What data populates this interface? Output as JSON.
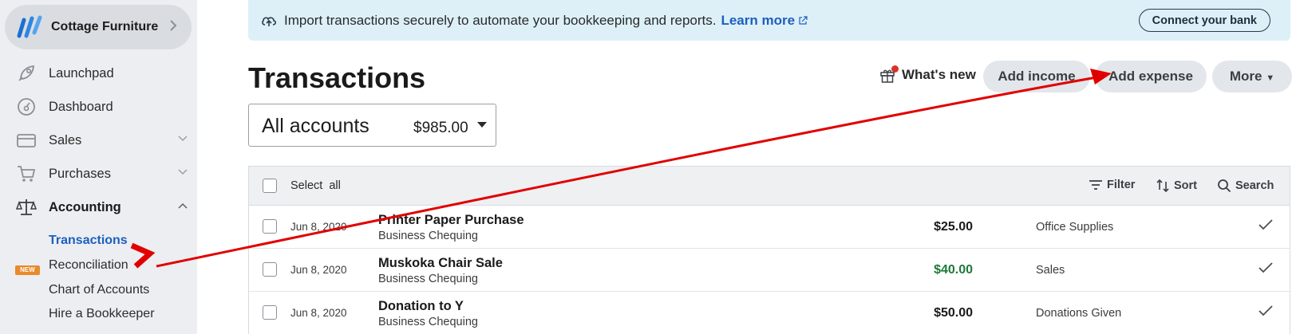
{
  "business": {
    "name": "Cottage Furniture"
  },
  "sidebar": {
    "items": [
      {
        "label": "Launchpad",
        "icon": "rocket-icon"
      },
      {
        "label": "Dashboard",
        "icon": "dashboard-icon"
      },
      {
        "label": "Sales",
        "icon": "sales-icon"
      },
      {
        "label": "Purchases",
        "icon": "cart-icon"
      },
      {
        "label": "Accounting",
        "icon": "scales-icon"
      }
    ],
    "accounting_subitems": [
      {
        "label": "Transactions",
        "active": true
      },
      {
        "label": "Reconciliation",
        "badge": "NEW"
      },
      {
        "label": "Chart of Accounts"
      },
      {
        "label": "Hire a Bookkeeper"
      }
    ]
  },
  "banner": {
    "message": "Import transactions securely to automate your bookkeeping and reports.",
    "link": "Learn more",
    "button": "Connect your bank"
  },
  "header": {
    "title": "Transactions",
    "whats_new": "What's new",
    "add_income": "Add income",
    "add_expense": "Add expense",
    "more": "More"
  },
  "account_selector": {
    "name": "All accounts",
    "balance": "$985.00"
  },
  "table": {
    "select_all": "Select  all",
    "tools": {
      "filter": "Filter",
      "sort": "Sort",
      "search": "Search"
    },
    "rows": [
      {
        "date": "Jun 8, 2020",
        "description": "Printer Paper Purchase",
        "account": "Business Chequing",
        "amount": "$25.00",
        "category": "Office Supplies",
        "type": "expense"
      },
      {
        "date": "Jun 8, 2020",
        "description": "Muskoka Chair Sale",
        "account": "Business Chequing",
        "amount": "$40.00",
        "category": "Sales",
        "type": "income"
      },
      {
        "date": "Jun 8, 2020",
        "description": "Donation to Y",
        "account": "Business Chequing",
        "amount": "$50.00",
        "category": "Donations Given",
        "type": "expense"
      }
    ]
  },
  "colors": {
    "accent": "#1d5fbf",
    "income": "#1e7a3a",
    "annotation": "#e10000",
    "badge": "#e98a2c"
  }
}
